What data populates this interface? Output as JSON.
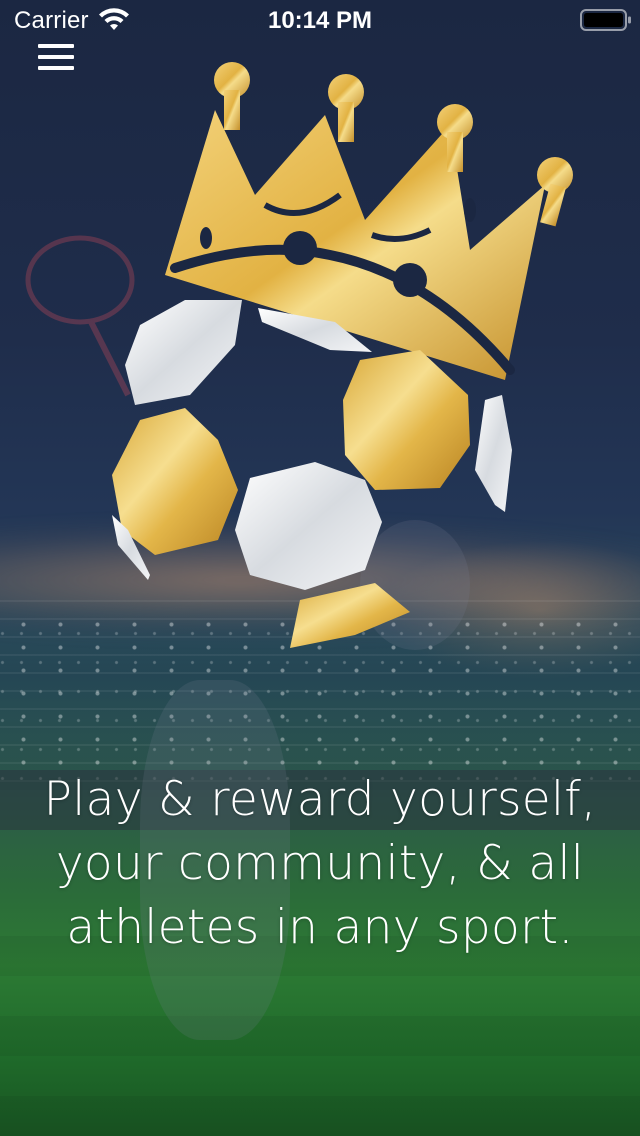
{
  "status_bar": {
    "carrier": "Carrier",
    "time": "10:14 PM",
    "wifi_icon": "wifi-icon",
    "battery_icon": "battery-full-icon"
  },
  "header": {
    "menu_icon": "hamburger-menu-icon"
  },
  "logo": {
    "description_icon": "crowned-soccer-ball-logo",
    "gold": "#e7b94a",
    "silver": "#e9ebee"
  },
  "hero": {
    "tagline": "Play & reward yourself, your community, & all athletes in any sport."
  },
  "colors": {
    "background_top": "#1b2742",
    "background_bottom": "#185522",
    "text": "#ffffff"
  }
}
